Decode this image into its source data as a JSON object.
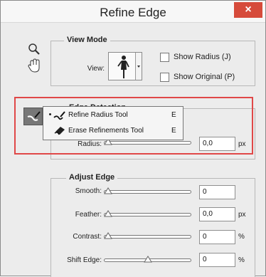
{
  "window": {
    "title": "Refine Edge",
    "close_label": "×"
  },
  "tools": {
    "zoom": "zoom-icon",
    "hand": "hand-icon",
    "brush": "brush-icon"
  },
  "view_mode": {
    "legend": "View Mode",
    "view_label": "View:",
    "show_radius": "Show Radius (J)",
    "show_original": "Show Original (P)"
  },
  "edge_detection": {
    "legend_partial": "Edge Detection",
    "radius_label": "Radius:",
    "radius_value": "0,0",
    "radius_unit": "px"
  },
  "menu": {
    "items": [
      {
        "label": "Refine Radius Tool",
        "shortcut": "E",
        "selected": true,
        "icon": "refine-radius-tool-icon"
      },
      {
        "label": "Erase Refinements Tool",
        "shortcut": "E",
        "selected": false,
        "icon": "erase-refinements-tool-icon"
      }
    ]
  },
  "adjust_edge": {
    "legend": "Adjust Edge",
    "rows": [
      {
        "label": "Smooth:",
        "value": "0",
        "unit": "",
        "slider_position": 0
      },
      {
        "label": "Feather:",
        "value": "0,0",
        "unit": "px",
        "slider_position": 0
      },
      {
        "label": "Contrast:",
        "value": "0",
        "unit": "%",
        "slider_position": 0
      },
      {
        "label": "Shift Edge:",
        "value": "0",
        "unit": "%",
        "slider_position": 0.5
      }
    ]
  },
  "colors": {
    "highlight": "#e04848",
    "close": "#d64b3b",
    "panel": "#ececec"
  }
}
